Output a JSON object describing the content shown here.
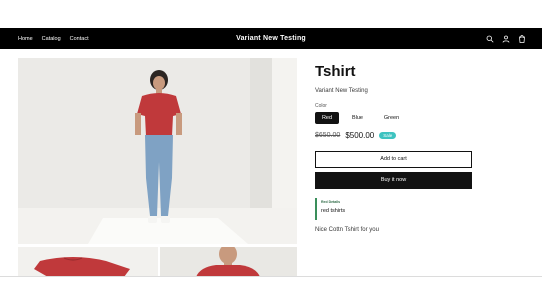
{
  "header": {
    "nav": [
      "Home",
      "Catalog",
      "Contact"
    ],
    "store_title": "Variant New Testing",
    "icons": [
      "search-icon",
      "account-icon",
      "cart-icon"
    ]
  },
  "product": {
    "title": "Tshirt",
    "vendor": "Variant New Testing",
    "color_label": "Color",
    "colors": [
      "Red",
      "Blue",
      "Green"
    ],
    "selected_color": "Red",
    "old_price": "$650.00",
    "new_price": "$500.00",
    "sale_badge": "Sale",
    "add_to_cart": "Add to cart",
    "buy_now": "Buy it now",
    "details_title": "Red Details",
    "details_text": "red tshirts",
    "description": "Nice Cottn Tshirt for you"
  },
  "colors": {
    "header_bg": "#000000",
    "sale_badge": "#3ec3c0",
    "details_border": "#3a8f5b",
    "tshirt_red": "#c0393b"
  }
}
